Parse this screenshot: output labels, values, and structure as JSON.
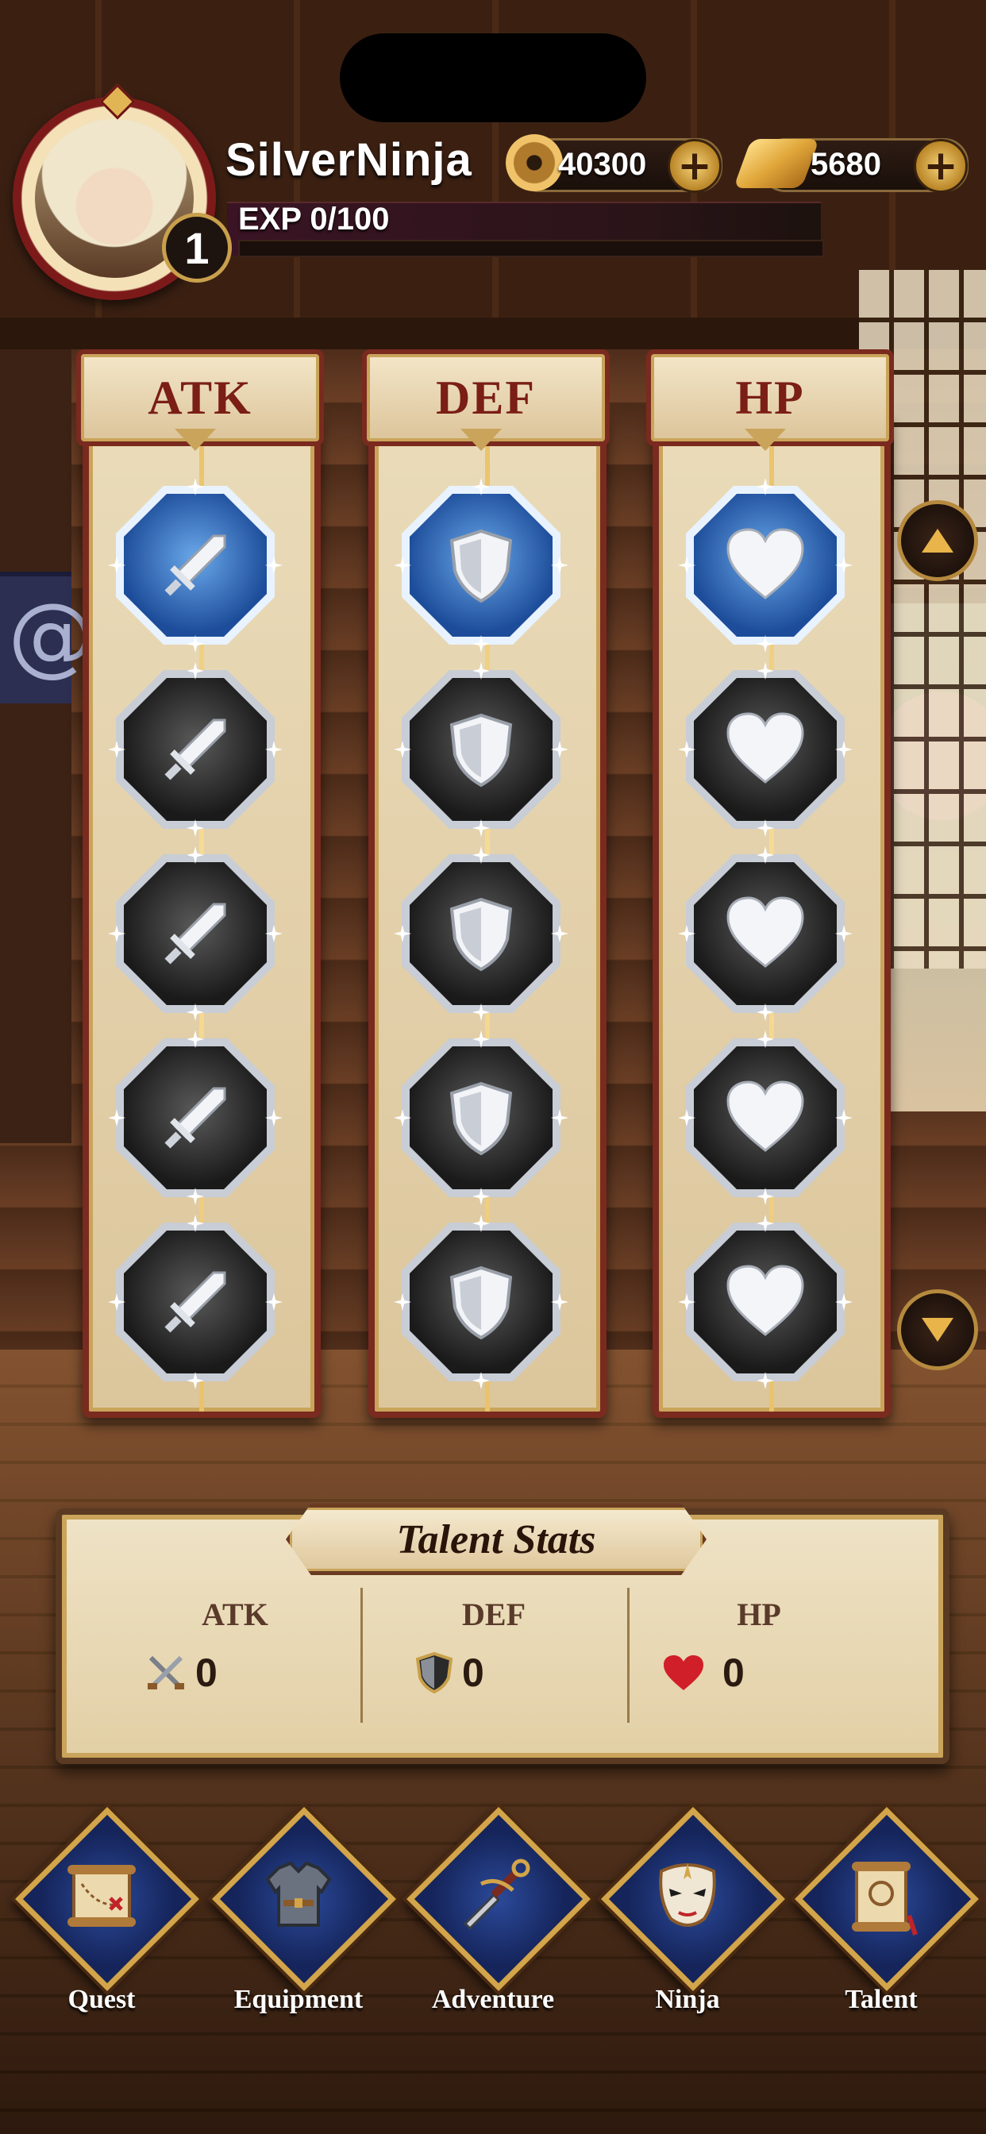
{
  "player": {
    "name": "SilverNinja",
    "level": "1",
    "exp_text": "EXP 0/100",
    "exp_progress": 0
  },
  "currencies": [
    {
      "icon": "coin-icon",
      "value": "40300"
    },
    {
      "icon": "gold-ingot-icon",
      "value": "5680"
    }
  ],
  "talent_columns": [
    {
      "title": "ATK",
      "icon": "sword-icon",
      "unlocked_nodes": 1,
      "total_nodes": 5
    },
    {
      "title": "DEF",
      "icon": "shield-icon",
      "unlocked_nodes": 1,
      "total_nodes": 5
    },
    {
      "title": "HP",
      "icon": "heart-icon",
      "unlocked_nodes": 1,
      "total_nodes": 5
    }
  ],
  "talent_stats": {
    "title": "Talent Stats",
    "stats": [
      {
        "label": "ATK",
        "icon": "crossed-swords-icon",
        "value": "0"
      },
      {
        "label": "DEF",
        "icon": "shield-icon",
        "value": "0"
      },
      {
        "label": "HP",
        "icon": "heart-icon",
        "value": "0"
      }
    ]
  },
  "nav": [
    {
      "label": "Quest",
      "icon": "scroll-map-icon"
    },
    {
      "label": "Equipment",
      "icon": "armor-icon"
    },
    {
      "label": "Adventure",
      "icon": "kunai-icon"
    },
    {
      "label": "Ninja",
      "icon": "mask-icon"
    },
    {
      "label": "Talent",
      "icon": "talent-scroll-icon"
    }
  ],
  "colors": {
    "active_node": "#1d4d9a",
    "locked_node": "#1a1a1a",
    "frame_red": "#7a2a1e",
    "gold": "#d3a54a",
    "nav_blue": "#15245a"
  }
}
